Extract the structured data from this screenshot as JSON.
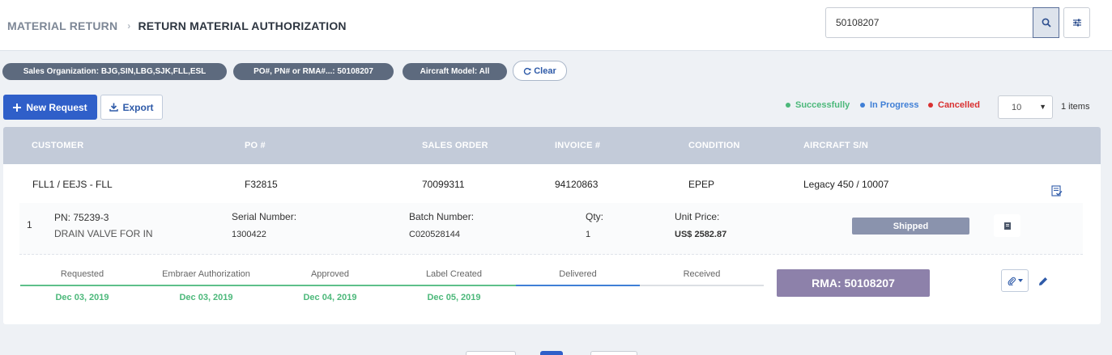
{
  "breadcrumb": {
    "parent": "MATERIAL RETURN",
    "current": "RETURN MATERIAL AUTHORIZATION"
  },
  "search": {
    "value": "50108207"
  },
  "filters": {
    "sales_org": "Sales Organization: BJG,SIN,LBG,SJK,FLL,ESL",
    "po_pn_rma": "PO#, PN# or RMA#...: 50108207",
    "aircraft_model": "Aircraft Model: All",
    "clear_label": "Clear"
  },
  "toolbar": {
    "new_request_label": "New Request",
    "export_label": "Export"
  },
  "legend": {
    "successfully": {
      "label": "Successfully",
      "color": "#4cb87a"
    },
    "in_progress": {
      "label": "In Progress",
      "color": "#3f7fd6"
    },
    "cancelled": {
      "label": "Cancelled",
      "color": "#d93030"
    }
  },
  "pagination": {
    "page_size": "10",
    "items_label": "1 items"
  },
  "table": {
    "headers": {
      "customer": "CUSTOMER",
      "po": "PO #",
      "sales_order": "SALES ORDER",
      "invoice": "INVOICE #",
      "condition": "CONDITION",
      "aircraft_sn": "AIRCRAFT S/N"
    },
    "row": {
      "customer": "FLL1 / EEJS - FLL",
      "po": "F32815",
      "sales_order": "70099311",
      "invoice": "94120863",
      "condition": "EPEP",
      "aircraft_sn": "Legacy 450 / 10007"
    }
  },
  "line_item": {
    "index": "1",
    "pn": "PN: 75239-3",
    "description": "DRAIN VALVE FOR IN",
    "serial_label": "Serial Number:",
    "serial_value": "1300422",
    "batch_label": "Batch Number:",
    "batch_value": "C020528144",
    "qty_label": "Qty:",
    "qty_value": "1",
    "unit_price_label": "Unit Price:",
    "unit_price_value": "US$ 2582.87",
    "status": "Shipped"
  },
  "steps": [
    {
      "name": "Requested",
      "date": "Dec 03, 2019",
      "state": "done"
    },
    {
      "name": "Embraer Authorization",
      "date": "Dec 03, 2019",
      "state": "done"
    },
    {
      "name": "Approved",
      "date": "Dec 04, 2019",
      "state": "done"
    },
    {
      "name": "Label Created",
      "date": "Dec 05, 2019",
      "state": "done"
    },
    {
      "name": "Delivered",
      "date": "",
      "state": "current"
    },
    {
      "name": "Received",
      "date": "",
      "state": "pending"
    }
  ],
  "rma": {
    "label": "RMA: 50108207"
  }
}
